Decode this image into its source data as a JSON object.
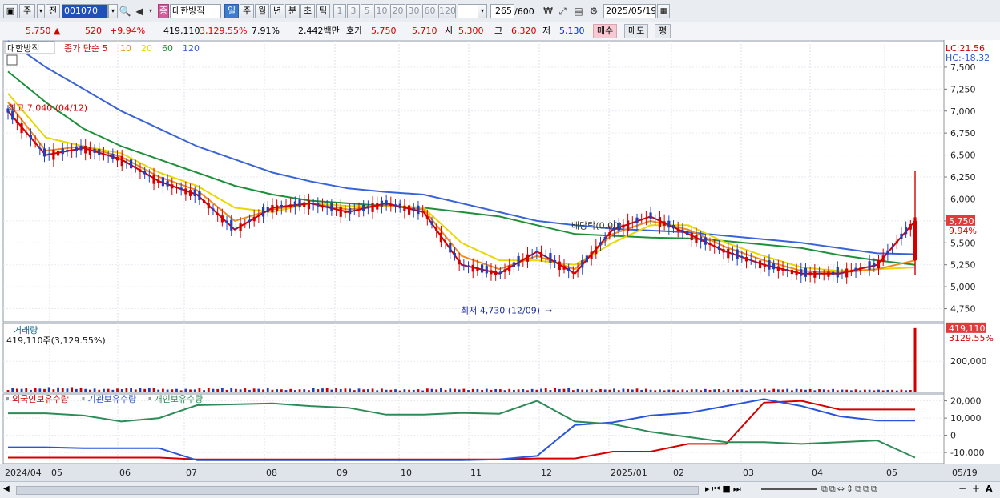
{
  "toolbar": {
    "market_btn": "주",
    "prev_btn": "전",
    "code": "001070",
    "jong_badge": "종",
    "name": "대한방직",
    "periods": [
      {
        "label": "일",
        "active": true
      },
      {
        "label": "주",
        "active": false
      },
      {
        "label": "월",
        "active": false
      },
      {
        "label": "년",
        "active": false
      },
      {
        "label": "분",
        "active": false
      },
      {
        "label": "초",
        "active": false
      },
      {
        "label": "틱",
        "active": false
      }
    ],
    "intervals": [
      "1",
      "3",
      "5",
      "10",
      "20",
      "30",
      "60",
      "120"
    ],
    "count": "265",
    "count_total": "/600",
    "date": "2025/05/19"
  },
  "quote": {
    "price": "5,750",
    "arrow": "▲",
    "change": "520",
    "change_pct": "+9.94%",
    "volume": "419,110",
    "volume_pct": "3,129.55%",
    "turnover": "7.91%",
    "amount": "2,442백만",
    "bid_label": "호가",
    "ask": "5,750",
    "bid": "5,710",
    "open_label": "시",
    "open": "5,300",
    "high_label": "고",
    "high": "6,320",
    "low_label": "저",
    "low": "5,130",
    "buy_btn": "매수",
    "sell_btn": "매도",
    "eval_btn": "평"
  },
  "price_panel": {
    "name_tag": "대한방직",
    "legend": [
      {
        "text": "종가 단순 5",
        "color": "#d40000"
      },
      {
        "text": "10",
        "color": "#f08c1c"
      },
      {
        "text": "20",
        "color": "#e8d800"
      },
      {
        "text": "60",
        "color": "#1e8f3a"
      },
      {
        "text": "120",
        "color": "#3a63d8"
      }
    ],
    "lc": "LC:21.56",
    "hc": "HC:-18.32",
    "current_price_tag": "5,750",
    "current_pct_tag": "9.94%",
    "high_annot": "최고 7,040 (04/12)",
    "low_annot": "최저 4,730 (12/09)",
    "dividend_annot": "배당락(0.00)"
  },
  "volume_panel": {
    "title": "거래량",
    "value_line": "419,110주(3,129.55%)",
    "tag_value": "419,110",
    "tag_pct": "3129.55%",
    "tick": "200,000"
  },
  "holding_panel": {
    "legend": [
      {
        "text": "외국인보유수량",
        "color": "#d40000"
      },
      {
        "text": "기관보유수량",
        "color": "#2b55d8"
      },
      {
        "text": "개인보유수량",
        "color": "#2e8b57"
      }
    ],
    "ticks": [
      "20,000",
      "10,000",
      "0",
      "-10,000"
    ]
  },
  "x_labels": [
    "2024/04",
    "05",
    "06",
    "07",
    "08",
    "09",
    "10",
    "11",
    "12",
    "2025/01",
    "02",
    "03",
    "04",
    "05",
    "05/19"
  ],
  "chart_data": [
    {
      "type": "line",
      "title": "대한방직",
      "ylim": [
        4600,
        7800
      ],
      "y_ticks": [
        4750,
        5000,
        5250,
        5500,
        5750,
        6000,
        6250,
        6500,
        6750,
        7000,
        7250,
        7500
      ],
      "x": [
        "2024/04",
        "05",
        "06",
        "07",
        "08",
        "09",
        "10",
        "11",
        "12",
        "2025/01",
        "02",
        "03",
        "04",
        "05",
        "05/19"
      ],
      "series": [
        {
          "name": "종가 단순 5",
          "color": "#d40000",
          "values": [
            7000,
            6500,
            6580,
            6450,
            6200,
            6050,
            5650,
            5900,
            5950,
            5850,
            5950,
            5850,
            5250,
            5150,
            5400,
            5150,
            5650,
            5800,
            5600,
            5400,
            5250,
            5150,
            5150,
            5250,
            5750
          ]
        },
        {
          "name": "10",
          "color": "#f08c1c",
          "values": [
            7100,
            6550,
            6600,
            6480,
            6250,
            6100,
            5750,
            5880,
            5950,
            5880,
            5930,
            5880,
            5350,
            5200,
            5350,
            5200,
            5600,
            5750,
            5650,
            5450,
            5300,
            5180,
            5160,
            5200,
            5300
          ]
        },
        {
          "name": "20",
          "color": "#e8d800",
          "values": [
            7200,
            6700,
            6600,
            6520,
            6300,
            6150,
            5900,
            5850,
            5950,
            5920,
            5920,
            5900,
            5500,
            5300,
            5300,
            5250,
            5500,
            5700,
            5700,
            5500,
            5350,
            5220,
            5180,
            5200,
            5220
          ]
        },
        {
          "name": "60",
          "color": "#1e8f3a",
          "values": [
            7450,
            7100,
            6800,
            6600,
            6450,
            6300,
            6150,
            6050,
            5980,
            5950,
            5920,
            5900,
            5850,
            5800,
            5700,
            5600,
            5580,
            5560,
            5550,
            5520,
            5480,
            5440,
            5360,
            5300,
            5250
          ]
        },
        {
          "name": "120",
          "color": "#3a63d8",
          "values": [
            7800,
            7500,
            7250,
            7000,
            6800,
            6600,
            6450,
            6300,
            6200,
            6120,
            6080,
            6050,
            5950,
            5850,
            5750,
            5700,
            5660,
            5640,
            5620,
            5580,
            5540,
            5500,
            5440,
            5380,
            5370
          ]
        }
      ],
      "annotations": [
        {
          "text": "최고 7,040 (04/12)",
          "value": 7040
        },
        {
          "text": "최저 4,730 (12/09)",
          "value": 4730
        },
        {
          "text": "배당락(0.00)"
        }
      ]
    },
    {
      "type": "bar",
      "title": "거래량",
      "ylim": [
        0,
        450000
      ],
      "y_ticks": [
        200000
      ],
      "last_value": 419110,
      "base_values": [
        17000,
        21000,
        14000,
        18000,
        13000,
        16000,
        15000,
        12000,
        17000,
        14000,
        11000,
        15000,
        13000,
        12000,
        16000,
        12000,
        14000,
        10000,
        12000,
        11000,
        13000,
        12000,
        10000,
        9000,
        419110
      ]
    },
    {
      "type": "line",
      "title": "보유수량",
      "ylim": [
        -16000,
        24000
      ],
      "y_ticks": [
        -10000,
        0,
        10000,
        20000
      ],
      "series": [
        {
          "name": "외국인보유수량",
          "color": "#d40000",
          "values": [
            -13000,
            -13000,
            -13000,
            -13000,
            -13000,
            -14000,
            -14000,
            -14000,
            -14000,
            -14000,
            -14000,
            -14000,
            -14000,
            -14000,
            -13500,
            -13500,
            -9500,
            -9500,
            -5000,
            -5000,
            19000,
            20000,
            15000,
            15000,
            15000
          ]
        },
        {
          "name": "기관보유수량",
          "color": "#2b55d8",
          "values": [
            -7000,
            -7000,
            -7500,
            -7500,
            -7500,
            -14500,
            -14500,
            -14500,
            -14500,
            -14500,
            -14500,
            -14500,
            -14500,
            -14000,
            -12000,
            6000,
            7500,
            11500,
            13000,
            17000,
            21000,
            17000,
            11000,
            8500,
            8500
          ]
        },
        {
          "name": "개인보유수량",
          "color": "#2e8b57",
          "values": [
            12800,
            12800,
            11500,
            8000,
            10000,
            17500,
            18000,
            18500,
            17000,
            16000,
            12000,
            12000,
            13000,
            12500,
            20000,
            8000,
            6500,
            2000,
            -1000,
            -4000,
            -4000,
            -5000,
            -4000,
            -3000,
            -13000
          ]
        }
      ]
    }
  ]
}
